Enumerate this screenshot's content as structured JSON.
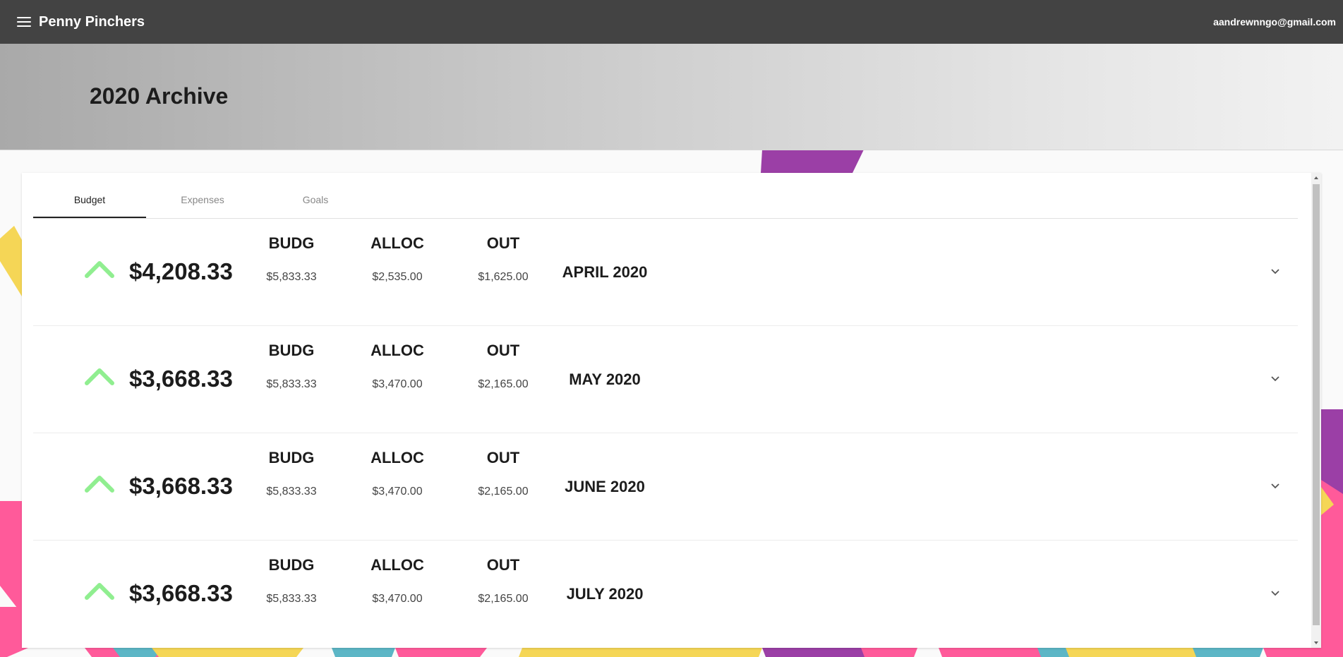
{
  "app": {
    "title": "Penny Pinchers",
    "user_email": "aandrewnngo@gmail.com"
  },
  "page": {
    "title": "2020 Archive"
  },
  "tabs": [
    {
      "label": "Budget",
      "active": true
    },
    {
      "label": "Expenses",
      "active": false
    },
    {
      "label": "Goals",
      "active": false
    }
  ],
  "columns": {
    "budg": "BUDG",
    "alloc": "ALLOC",
    "out": "OUT"
  },
  "rows": [
    {
      "total": "$4,208.33",
      "budg": "$5,833.33",
      "alloc": "$2,535.00",
      "out": "$1,625.00",
      "month": "APRIL 2020"
    },
    {
      "total": "$3,668.33",
      "budg": "$5,833.33",
      "alloc": "$3,470.00",
      "out": "$2,165.00",
      "month": "MAY 2020"
    },
    {
      "total": "$3,668.33",
      "budg": "$5,833.33",
      "alloc": "$3,470.00",
      "out": "$2,165.00",
      "month": "JUNE 2020"
    },
    {
      "total": "$3,668.33",
      "budg": "$5,833.33",
      "alloc": "$3,470.00",
      "out": "$2,165.00",
      "month": "JULY 2020"
    }
  ],
  "icons": {
    "trend": "arrow-up-icon",
    "expand": "chevron-down-icon",
    "menu": "menu-icon"
  },
  "colors": {
    "appbar": "#434343",
    "trend_up": "#90ee90",
    "purple": "#9b3fa6",
    "pink": "#ff5a9a",
    "yellow": "#f5d656",
    "teal": "#5cb6c6"
  }
}
